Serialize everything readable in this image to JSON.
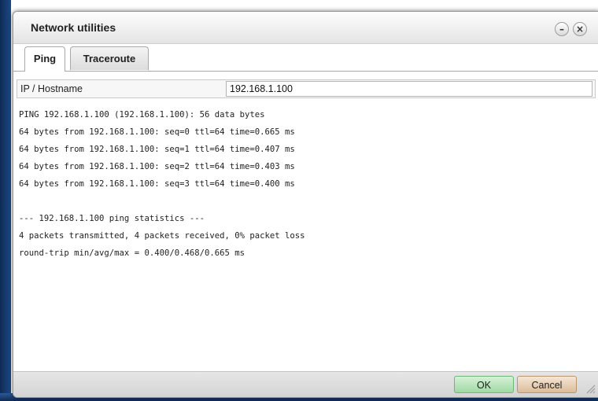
{
  "window": {
    "title": "Network utilities",
    "minimize_symbol": "–",
    "close_symbol": "×"
  },
  "tabs": [
    {
      "label": "Ping",
      "active": true
    },
    {
      "label": "Traceroute",
      "active": false
    }
  ],
  "form": {
    "host_label": "IP / Hostname",
    "host_value": "192.168.1.100"
  },
  "output": {
    "lines": [
      "PING 192.168.1.100 (192.168.1.100): 56 data bytes",
      "64 bytes from 192.168.1.100: seq=0 ttl=64 time=0.665 ms",
      "64 bytes from 192.168.1.100: seq=1 ttl=64 time=0.407 ms",
      "64 bytes from 192.168.1.100: seq=2 ttl=64 time=0.403 ms",
      "64 bytes from 192.168.1.100: seq=3 ttl=64 time=0.400 ms",
      "",
      "--- 192.168.1.100 ping statistics ---",
      "4 packets transmitted, 4 packets received, 0% packet loss",
      "round-trip min/avg/max = 0.400/0.468/0.665 ms"
    ]
  },
  "footer": {
    "ok_label": "OK",
    "cancel_label": "Cancel"
  },
  "icons": [
    "minimize-icon",
    "close-icon",
    "resize-grip-icon"
  ],
  "colors": {
    "ok_button": "#a8dcab",
    "cancel_button": "#e3c6a6",
    "desktop_background": "#1d4a86"
  }
}
